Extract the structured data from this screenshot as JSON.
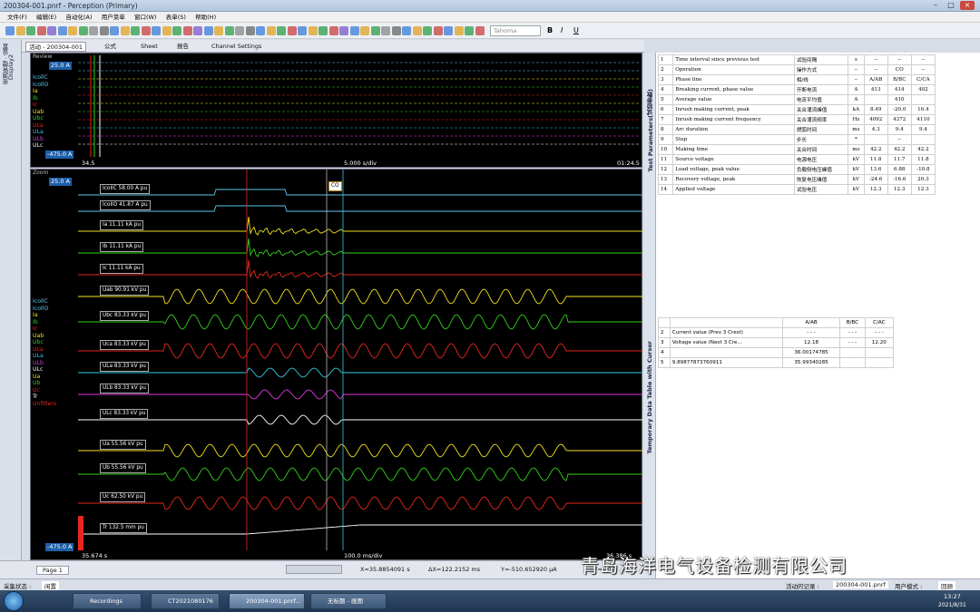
{
  "window": {
    "title": "200304-001.pnrf - Perception (Primary)"
  },
  "menu": [
    "文件(F)",
    "编辑(E)",
    "自动化(A)",
    "用户菜单",
    "窗口(W)",
    "表单(S)",
    "帮助(H)"
  ],
  "toolbar": {
    "font": "Tahoma",
    "bold": "B",
    "italic": "I",
    "underline": "U"
  },
  "tabs": [
    "活动 - 200304-001",
    "公式",
    "Sheet",
    "报告",
    "Channel Settings"
  ],
  "sidebar": {
    "label1": "Display2",
    "label2": "资源管理 · 设置"
  },
  "review": {
    "label": "Review",
    "scale_top": "25.0 A",
    "scale_bottom": "-475.0 A",
    "channels": [
      "IcollC",
      "IcollO",
      "Ia",
      "Ib",
      "Ic",
      "Uab",
      "Ubc",
      "Uca",
      "ULa",
      "ULb",
      "ULc"
    ],
    "time_left": "34.5",
    "time_div": "5.000 s/div",
    "time_right": "01:24.5"
  },
  "zoom": {
    "label": "Zoom",
    "scale_top": "25.0 A",
    "scale_bottom": "-475.0 A",
    "co": "CO",
    "channels": [
      "IcollC",
      "IcollO",
      "Ia",
      "Ib",
      "Ic",
      "Uab",
      "Ubc",
      "Uca",
      "ULa",
      "ULb",
      "ULc",
      "Ua",
      "Ub",
      "Uc",
      "Tr",
      "Unfilters"
    ],
    "time_left": "35.674 s",
    "time_div": "100.0 ms/div",
    "time_right": "36.386 s",
    "traces": [
      {
        "label": "IcollC 58.00 A pu",
        "color": "#5cc8e8"
      },
      {
        "label": "IcollO 41.87 A pu",
        "color": "#5cc8e8"
      },
      {
        "label": "Ia 11.11 kA pu",
        "color": "#f2e21c"
      },
      {
        "label": "Ib 11.11 kA pu",
        "color": "#33d21a"
      },
      {
        "label": "Ic 11.11 kA pu",
        "color": "#e8281c"
      },
      {
        "label": "Uab 90.91 kV pu",
        "color": "#f2e21c"
      },
      {
        "label": "Ubc 83.33 kV pu",
        "color": "#33d21a"
      },
      {
        "label": "Uca 83.33 kV pu",
        "color": "#e8281c"
      },
      {
        "label": "ULa 83.33 kV pu",
        "color": "#33c8e0"
      },
      {
        "label": "ULb 83.33 kV pu",
        "color": "#e039e0"
      },
      {
        "label": "ULc 83.33 kV pu",
        "color": "#ffffff"
      },
      {
        "label": "Ua 55.56 kV pu",
        "color": "#f2e21c"
      },
      {
        "label": "Ub 55.56 kV pu",
        "color": "#33d21a"
      },
      {
        "label": "Uc 62.50 kV pu",
        "color": "#e8281c"
      },
      {
        "label": "Tr 132.5 mm pu",
        "color": "#ffffff"
      }
    ]
  },
  "params": {
    "side_label": "Test Parameters(试验参数)",
    "rows": [
      [
        "1",
        "Time interval since previous test",
        "试验间隔",
        "s",
        "--",
        "--",
        "--"
      ],
      [
        "2",
        "Operation",
        "操作方式",
        "--",
        "--",
        "CO",
        "--"
      ],
      [
        "3",
        "Phase line",
        "相/线",
        "--",
        "A/AB",
        "B/BC",
        "C/CA"
      ],
      [
        "4",
        "Breaking current, phase value",
        "开断电流",
        "A",
        "413",
        "414",
        "402"
      ],
      [
        "5",
        "Average value",
        "电流平均值",
        "A",
        "",
        "410",
        ""
      ],
      [
        "6",
        "Inrush making current, peak",
        "关合涌流峰值",
        "kA",
        "8.49",
        "-20.0",
        "16.4"
      ],
      [
        "7",
        "Inrush making current frequency",
        "关合涌流频率",
        "Hz",
        "4092",
        "4372",
        "4110"
      ],
      [
        "8",
        "Arc duration",
        "燃弧时间",
        "ms",
        "4.3",
        "9.4",
        "9.4"
      ],
      [
        "9",
        "Step",
        "步长",
        "*",
        "",
        "--",
        ""
      ],
      [
        "10",
        "Making time",
        "关合时间",
        "ms",
        "42.2",
        "42.2",
        "42.2"
      ],
      [
        "11",
        "Source voltage",
        "电源电压",
        "kV",
        "11.8",
        "11.7",
        "11.8"
      ],
      [
        "12",
        "Load voltage, peak value",
        "负载侧电压峰值",
        "kV",
        "13.6",
        "6.88",
        "-10.8"
      ],
      [
        "13",
        "Recovery voltage, peak",
        "恢复电压峰值",
        "kV",
        "-24.6",
        "-16.6",
        "20.3"
      ],
      [
        "14",
        "Applied voltage",
        "试验电压",
        "kV",
        "12.3",
        "12.3",
        "12.3"
      ]
    ]
  },
  "temp": {
    "side_label": "Temporary Data Table with Cursor",
    "header": [
      "",
      "",
      "A/AB",
      "B/BC",
      "C/AC"
    ],
    "rows": [
      [
        "2",
        "Current value (Prev 3 Crest)",
        "- - -",
        "- - -",
        "- - -"
      ],
      [
        "3",
        "Voltage value (Next 3 Cre...",
        "12.18",
        "- - -",
        "12.20"
      ],
      [
        "4",
        "",
        "36.00174785",
        "",
        ""
      ],
      [
        "5",
        "9.89877873760911",
        "35.99340285",
        "",
        ""
      ]
    ]
  },
  "status": {
    "page": "Page 1",
    "x": "X=35.8854091 s",
    "dx": "ΔX=122.2152 ms",
    "y": "Y=-510.652920 µA",
    "dy": "ΔY=-417"
  },
  "info": {
    "left": "采集状态 :",
    "left2": "闲置",
    "activity": "活动的记录 :",
    "file": "200304-001.pnrf",
    "mode": "用户模式 :",
    "mode2": "回顾"
  },
  "taskbar": {
    "items": [
      "Recordings",
      "CT2021080176",
      "200304-001.pnrf...",
      "无标题 - 画图"
    ],
    "time": "13:27",
    "date": "2021/8/31"
  },
  "watermark": "青岛海洋电气设备检测有限公司"
}
